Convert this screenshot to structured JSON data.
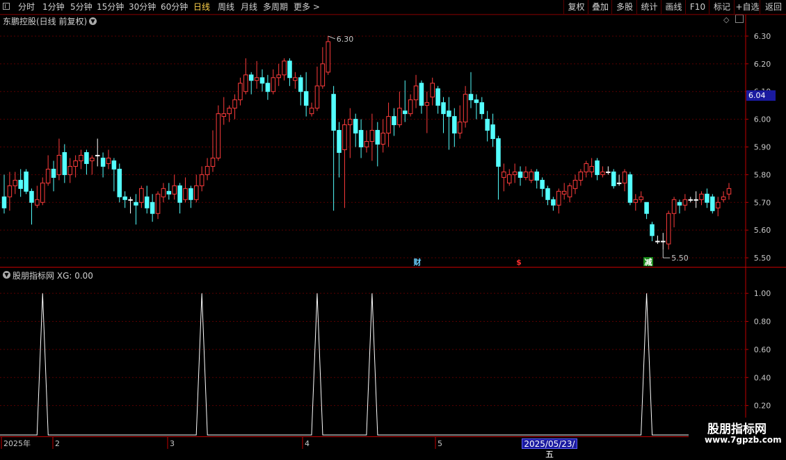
{
  "toolbar": {
    "periods": [
      {
        "label": "分时",
        "active": false
      },
      {
        "label": "1分钟",
        "active": false
      },
      {
        "label": "5分钟",
        "active": false
      },
      {
        "label": "15分钟",
        "active": false
      },
      {
        "label": "30分钟",
        "active": false
      },
      {
        "label": "60分钟",
        "active": false
      },
      {
        "label": "日线",
        "active": true
      },
      {
        "label": "周线",
        "active": false
      },
      {
        "label": "月线",
        "active": false
      },
      {
        "label": "多周期",
        "active": false
      },
      {
        "label": "更多 >",
        "active": false
      }
    ],
    "right_buttons": [
      "复权",
      "叠加",
      "多股",
      "统计",
      "画线",
      "F10",
      "标记",
      "+自选",
      "返回"
    ]
  },
  "main_chart": {
    "title": "东鹏控股(日线 前复权)",
    "high_label": "6.30",
    "low_label": "5.50",
    "current_price": "6.04",
    "y_ticks": [
      "6.30",
      "6.20",
      "6.10",
      "6.00",
      "5.90",
      "5.80",
      "5.70",
      "5.60",
      "5.50"
    ],
    "markers": [
      {
        "text": "财",
        "color": "#6ad0ff"
      },
      {
        "text": "$",
        "color": "#ff3030"
      },
      {
        "text": "减",
        "color": "#ffffff",
        "bg": "#1a8a1a"
      }
    ]
  },
  "indicator": {
    "name": "股朋指标网",
    "series_label": "XG: 0.00",
    "y_ticks": [
      "1.00",
      "0.80",
      "0.60",
      "0.40",
      "0.20"
    ]
  },
  "x_axis": {
    "labels": [
      "2025年",
      "2",
      "3",
      "4",
      "5"
    ],
    "cursor_date": "2025/05/23/五"
  },
  "watermark": {
    "name": "股朋指标网",
    "url": "www.7gpzb.com"
  },
  "chart_data": {
    "type": "candlestick",
    "ylim": [
      5.47,
      6.34
    ],
    "colors": {
      "up": "#ff3c3c",
      "down": "#54ffff",
      "flat": "#ffffff"
    },
    "candles": [
      [
        5.72,
        5.68,
        5.8,
        5.66
      ],
      [
        5.72,
        5.76,
        5.81,
        5.67
      ],
      [
        5.76,
        5.78,
        5.81,
        5.73
      ],
      [
        5.78,
        5.75,
        5.82,
        5.72
      ],
      [
        5.81,
        5.74,
        5.82,
        5.73
      ],
      [
        5.74,
        5.7,
        5.75,
        5.62
      ],
      [
        5.69,
        5.71,
        5.76,
        5.68
      ],
      [
        5.7,
        5.77,
        5.79,
        5.69
      ],
      [
        5.77,
        5.82,
        5.87,
        5.76
      ],
      [
        5.82,
        5.79,
        5.85,
        5.74
      ],
      [
        5.8,
        5.87,
        5.93,
        5.78
      ],
      [
        5.88,
        5.8,
        5.91,
        5.77
      ],
      [
        5.8,
        5.83,
        5.86,
        5.77
      ],
      [
        5.83,
        5.85,
        5.87,
        5.79
      ],
      [
        5.85,
        5.87,
        5.89,
        5.82
      ],
      [
        5.88,
        5.84,
        5.89,
        5.8
      ],
      [
        5.85,
        5.86,
        5.87,
        5.8
      ],
      [
        5.87,
        5.87,
        5.93,
        5.83
      ],
      [
        5.86,
        5.83,
        5.88,
        5.79
      ],
      [
        5.84,
        5.86,
        5.89,
        5.82
      ],
      [
        5.85,
        5.82,
        5.86,
        5.74
      ],
      [
        5.82,
        5.72,
        5.84,
        5.7
      ],
      [
        5.72,
        5.71,
        5.74,
        5.68
      ],
      [
        5.71,
        5.71,
        5.72,
        5.66
      ],
      [
        5.7,
        5.69,
        5.73,
        5.62
      ],
      [
        5.7,
        5.75,
        5.76,
        5.68
      ],
      [
        5.72,
        5.68,
        5.76,
        5.66
      ],
      [
        5.7,
        5.66,
        5.73,
        5.63
      ],
      [
        5.66,
        5.73,
        5.74,
        5.64
      ],
      [
        5.72,
        5.75,
        5.77,
        5.7
      ],
      [
        5.74,
        5.73,
        5.77,
        5.71
      ],
      [
        5.73,
        5.76,
        5.8,
        5.71
      ],
      [
        5.76,
        5.7,
        5.77,
        5.66
      ],
      [
        5.71,
        5.75,
        5.79,
        5.7
      ],
      [
        5.75,
        5.71,
        5.76,
        5.68
      ],
      [
        5.71,
        5.76,
        5.8,
        5.7
      ],
      [
        5.76,
        5.8,
        5.83,
        5.74
      ],
      [
        5.8,
        5.83,
        5.86,
        5.78
      ],
      [
        5.83,
        5.86,
        5.96,
        5.81
      ],
      [
        5.86,
        6.02,
        6.05,
        5.85
      ],
      [
        6.01,
        6.02,
        6.08,
        5.98
      ],
      [
        6.02,
        6.04,
        6.05,
        5.99
      ],
      [
        6.04,
        6.07,
        6.09,
        6.0
      ],
      [
        6.07,
        6.13,
        6.15,
        6.05
      ],
      [
        6.1,
        6.16,
        6.22,
        6.09
      ],
      [
        6.16,
        6.14,
        6.17,
        6.09
      ],
      [
        6.14,
        6.15,
        6.21,
        6.11
      ],
      [
        6.15,
        6.13,
        6.18,
        6.1
      ],
      [
        6.13,
        6.1,
        6.16,
        6.07
      ],
      [
        6.1,
        6.15,
        6.18,
        6.09
      ],
      [
        6.15,
        6.16,
        6.2,
        6.12
      ],
      [
        6.16,
        6.21,
        6.22,
        6.14
      ],
      [
        6.21,
        6.15,
        6.22,
        6.12
      ],
      [
        6.14,
        6.15,
        6.17,
        6.11
      ],
      [
        6.15,
        6.1,
        6.16,
        6.05
      ],
      [
        6.1,
        6.05,
        6.17,
        6.01
      ],
      [
        6.02,
        6.04,
        6.06,
        6.01
      ],
      [
        6.04,
        6.12,
        6.19,
        6.03
      ],
      [
        6.12,
        6.2,
        6.26,
        6.11
      ],
      [
        6.17,
        6.28,
        6.3,
        6.16
      ],
      [
        6.09,
        5.96,
        6.12,
        5.67
      ],
      [
        5.96,
        5.88,
        5.99,
        5.79
      ],
      [
        5.89,
        5.98,
        6.0,
        5.68
      ],
      [
        5.98,
        6.0,
        6.04,
        5.86
      ],
      [
        6.0,
        5.95,
        6.02,
        5.9
      ],
      [
        5.96,
        5.9,
        6.0,
        5.86
      ],
      [
        5.9,
        5.92,
        5.96,
        5.88
      ],
      [
        5.92,
        5.96,
        6.02,
        5.85
      ],
      [
        5.96,
        5.91,
        5.99,
        5.83
      ],
      [
        5.91,
        5.95,
        6.0,
        5.88
      ],
      [
        5.95,
        6.01,
        6.06,
        5.9
      ],
      [
        6.01,
        5.98,
        6.04,
        5.94
      ],
      [
        5.98,
        6.04,
        6.1,
        5.97
      ],
      [
        6.03,
        6.02,
        6.14,
        5.99
      ],
      [
        6.02,
        6.07,
        6.09,
        6.01
      ],
      [
        6.07,
        6.12,
        6.16,
        6.04
      ],
      [
        6.13,
        6.05,
        6.14,
        6.02
      ],
      [
        6.05,
        6.06,
        6.1,
        5.95
      ],
      [
        6.08,
        6.13,
        6.15,
        6.05
      ],
      [
        6.11,
        6.05,
        6.12,
        6.02
      ],
      [
        6.06,
        6.02,
        6.08,
        5.95
      ],
      [
        6.03,
        6.01,
        6.08,
        5.89
      ],
      [
        6.01,
        5.95,
        6.04,
        5.9
      ],
      [
        5.95,
        5.99,
        6.05,
        5.93
      ],
      [
        5.99,
        6.09,
        6.12,
        5.97
      ],
      [
        6.09,
        6.07,
        6.17,
        6.04
      ],
      [
        6.07,
        6.06,
        6.09,
        6.0
      ],
      [
        6.06,
        6.02,
        6.08,
        6.0
      ],
      [
        6.0,
        5.96,
        6.03,
        5.92
      ],
      [
        5.98,
        5.93,
        6.02,
        5.9
      ],
      [
        5.93,
        5.83,
        5.94,
        5.71
      ],
      [
        5.79,
        5.81,
        5.84,
        5.74
      ],
      [
        5.77,
        5.8,
        5.82,
        5.76
      ],
      [
        5.8,
        5.81,
        5.84,
        5.77
      ],
      [
        5.81,
        5.79,
        5.83,
        5.76
      ],
      [
        5.79,
        5.81,
        5.83,
        5.78
      ],
      [
        5.78,
        5.81,
        5.82,
        5.77
      ],
      [
        5.81,
        5.78,
        5.82,
        5.75
      ],
      [
        5.78,
        5.75,
        5.79,
        5.72
      ],
      [
        5.75,
        5.71,
        5.76,
        5.69
      ],
      [
        5.71,
        5.69,
        5.72,
        5.67
      ],
      [
        5.69,
        5.74,
        5.75,
        5.66
      ],
      [
        5.73,
        5.74,
        5.77,
        5.71
      ],
      [
        5.72,
        5.76,
        5.77,
        5.7
      ],
      [
        5.75,
        5.78,
        5.8,
        5.73
      ],
      [
        5.78,
        5.81,
        5.82,
        5.76
      ],
      [
        5.81,
        5.84,
        5.85,
        5.79
      ],
      [
        5.81,
        5.83,
        5.86,
        5.79
      ],
      [
        5.85,
        5.8,
        5.86,
        5.78
      ],
      [
        5.8,
        5.81,
        5.83,
        5.79
      ],
      [
        5.81,
        5.81,
        5.83,
        5.8
      ],
      [
        5.81,
        5.76,
        5.82,
        5.75
      ],
      [
        5.77,
        5.77,
        5.8,
        5.76
      ],
      [
        5.77,
        5.81,
        5.82,
        5.74
      ],
      [
        5.8,
        5.7,
        5.81,
        5.69
      ],
      [
        5.7,
        5.71,
        5.73,
        5.67
      ],
      [
        5.71,
        5.72,
        5.74,
        5.7
      ],
      [
        5.7,
        5.66,
        5.7,
        5.64
      ],
      [
        5.62,
        5.58,
        5.63,
        5.56
      ],
      [
        5.56,
        5.56,
        5.58,
        5.55
      ],
      [
        5.56,
        5.56,
        5.59,
        5.53
      ],
      [
        5.55,
        5.66,
        5.67,
        5.53
      ],
      [
        5.66,
        5.71,
        5.72,
        5.61
      ],
      [
        5.7,
        5.69,
        5.71,
        5.66
      ],
      [
        5.69,
        5.71,
        5.73,
        5.67
      ],
      [
        5.71,
        5.71,
        5.72,
        5.7
      ],
      [
        5.71,
        5.71,
        5.74,
        5.68
      ],
      [
        5.71,
        5.73,
        5.74,
        5.69
      ],
      [
        5.73,
        5.7,
        5.75,
        5.68
      ],
      [
        5.72,
        5.67,
        5.73,
        5.66
      ],
      [
        5.68,
        5.7,
        5.72,
        5.65
      ],
      [
        5.71,
        5.72,
        5.74,
        5.7
      ],
      [
        5.73,
        5.75,
        5.77,
        5.71
      ]
    ],
    "indicator_series": {
      "name": "XG",
      "ylim": [
        0,
        1.1
      ],
      "spike_index": [
        7,
        36,
        57,
        67,
        117
      ],
      "spike_value": 1.0
    }
  }
}
